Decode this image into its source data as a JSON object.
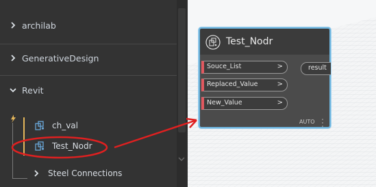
{
  "library": {
    "sections": [
      {
        "label": "archilab",
        "expanded": false
      },
      {
        "label": "GenerativeDesign",
        "expanded": false
      },
      {
        "label": "Revit",
        "expanded": true
      }
    ],
    "items": [
      {
        "label": "ch_val",
        "icon": "custom-node-icon"
      },
      {
        "label": "Test_Nodr",
        "icon": "custom-node-icon",
        "highlighted": true
      }
    ],
    "partial_item": {
      "label": "Steel Connections"
    }
  },
  "node": {
    "title": "Test_Nodr",
    "inputs": [
      {
        "label": "Souce_List",
        "arrow": ">"
      },
      {
        "label": "Replaced_Value",
        "arrow": ">"
      },
      {
        "label": "New_Value",
        "arrow": ">"
      }
    ],
    "output": {
      "label": "result"
    },
    "lacing": "AUTO"
  },
  "colors": {
    "sidebar_bg": "#333333",
    "accent_gold": "#e5b75b",
    "port_marker": "#e2585f",
    "node_border": "#6fb6df",
    "annotation_red": "#e02020"
  }
}
